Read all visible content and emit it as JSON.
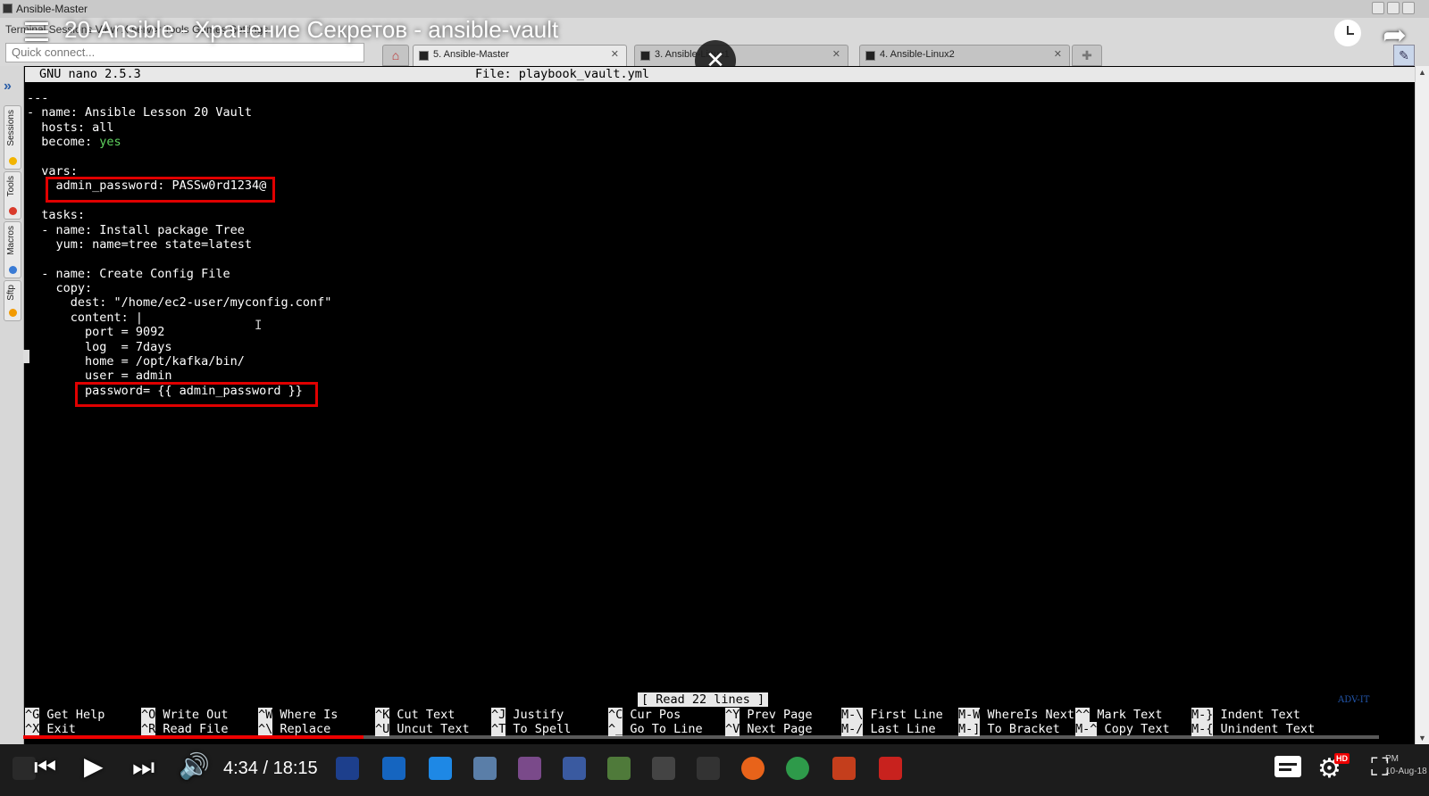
{
  "window": {
    "title": "Ansible-Master"
  },
  "toolbar": {
    "menu": "Terminal   Sessions   View   X server   Tools   Games   Settings",
    "quick_connect_placeholder": "Quick connect...",
    "home_icon": "home-icon",
    "tabs": [
      {
        "label": "5. Ansible-Master",
        "close": "✕"
      },
      {
        "label": "3. Ansible-Linux1",
        "close": "✕"
      },
      {
        "label": "4. Ansible-Linux2",
        "close": "✕"
      }
    ]
  },
  "overlay": {
    "video_title": "20-Ansible - Хранение Секретов - ansible-vault",
    "close": "✕",
    "share": "➦"
  },
  "sidebar": {
    "items": [
      {
        "label": "Sessions",
        "color": "#f2b400"
      },
      {
        "label": "Tools",
        "color": "#d93a2b"
      },
      {
        "label": "Macros",
        "color": "#3a7bd5"
      },
      {
        "label": "Sftp",
        "color": "#f29a00"
      }
    ]
  },
  "editor": {
    "version": "GNU nano 2.5.3",
    "file": "File: playbook_vault.yml",
    "lines": [
      "---",
      "- name: Ansible Lesson 20 Vault",
      "  hosts: all",
      "  become: ",
      "",
      "  vars:",
      "    admin_password: PASSw0rd1234@",
      "",
      "  tasks:",
      "  - name: Install package Tree",
      "    yum: name=tree state=latest",
      "",
      "  - name: Create Config File",
      "    copy:",
      "      dest: \"/home/ec2-user/myconfig.conf\"",
      "      content: |",
      "        port = 9092",
      "        log  = 7days",
      "        home = /opt/kafka/bin/",
      "        user = admin",
      "        password= {{ admin_password }}"
    ],
    "become_value": "yes",
    "status_message": "[ Read 22 lines ]",
    "shortcuts_row1": [
      {
        "key": "^G",
        "label": "Get Help"
      },
      {
        "key": "^O",
        "label": "Write Out"
      },
      {
        "key": "^W",
        "label": "Where Is"
      },
      {
        "key": "^K",
        "label": "Cut Text"
      },
      {
        "key": "^J",
        "label": "Justify"
      },
      {
        "key": "^C",
        "label": "Cur Pos"
      },
      {
        "key": "^Y",
        "label": "Prev Page"
      },
      {
        "key": "M-\\",
        "label": "First Line"
      },
      {
        "key": "M-W",
        "label": "WhereIs Next"
      },
      {
        "key": "^^",
        "label": "Mark Text"
      },
      {
        "key": "M-}",
        "label": "Indent Text"
      }
    ],
    "shortcuts_row2": [
      {
        "key": "^X",
        "label": "Exit"
      },
      {
        "key": "^R",
        "label": "Read File"
      },
      {
        "key": "^\\",
        "label": "Replace"
      },
      {
        "key": "^U",
        "label": "Uncut Text"
      },
      {
        "key": "^T",
        "label": "To Spell"
      },
      {
        "key": "^_",
        "label": "Go To Line"
      },
      {
        "key": "^V",
        "label": "Next Page"
      },
      {
        "key": "M-/",
        "label": "Last Line"
      },
      {
        "key": "M-]",
        "label": "To Bracket"
      },
      {
        "key": "M-^",
        "label": "Copy Text"
      },
      {
        "key": "M-{",
        "label": "Unindent Text"
      }
    ],
    "watermark": "ADV-IT"
  },
  "player": {
    "time": "4:34 / 18:15",
    "progress": 0.251,
    "hd": "HD",
    "tray_time": "PM",
    "tray_date": "10-Aug-18"
  },
  "colors": {
    "highlight_box": "#e00000",
    "progress": "#e00000",
    "yaml_bool": "#5fd35f"
  }
}
